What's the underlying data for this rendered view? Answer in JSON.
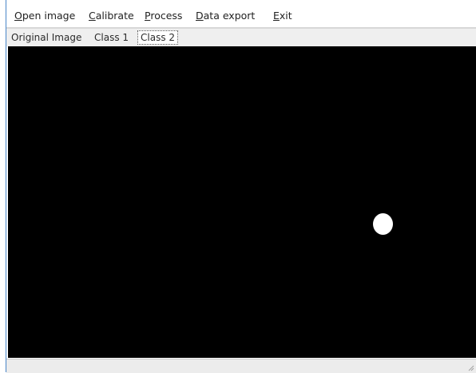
{
  "menu": {
    "open_image": {
      "mnemonic": "O",
      "rest": "pen image"
    },
    "calibrate": {
      "mnemonic": "C",
      "rest": "alibrate"
    },
    "process": {
      "mnemonic": "P",
      "rest": "rocess"
    },
    "data_export": {
      "mnemonic": "D",
      "rest": "ata export"
    },
    "exit": {
      "mnemonic": "E",
      "rest": "xit"
    }
  },
  "tabs": [
    {
      "label": "Original Image",
      "selected": false
    },
    {
      "label": "Class 1",
      "selected": false
    },
    {
      "label": "Class 2",
      "selected": true
    }
  ],
  "canvas": {
    "background_color": "#000000",
    "blob_color": "#ffffff"
  },
  "colors": {
    "window_edge": "#4a86c8",
    "tabbar_bg": "#efefef"
  },
  "icons": {
    "resize_grip": "resize-grip-icon"
  }
}
